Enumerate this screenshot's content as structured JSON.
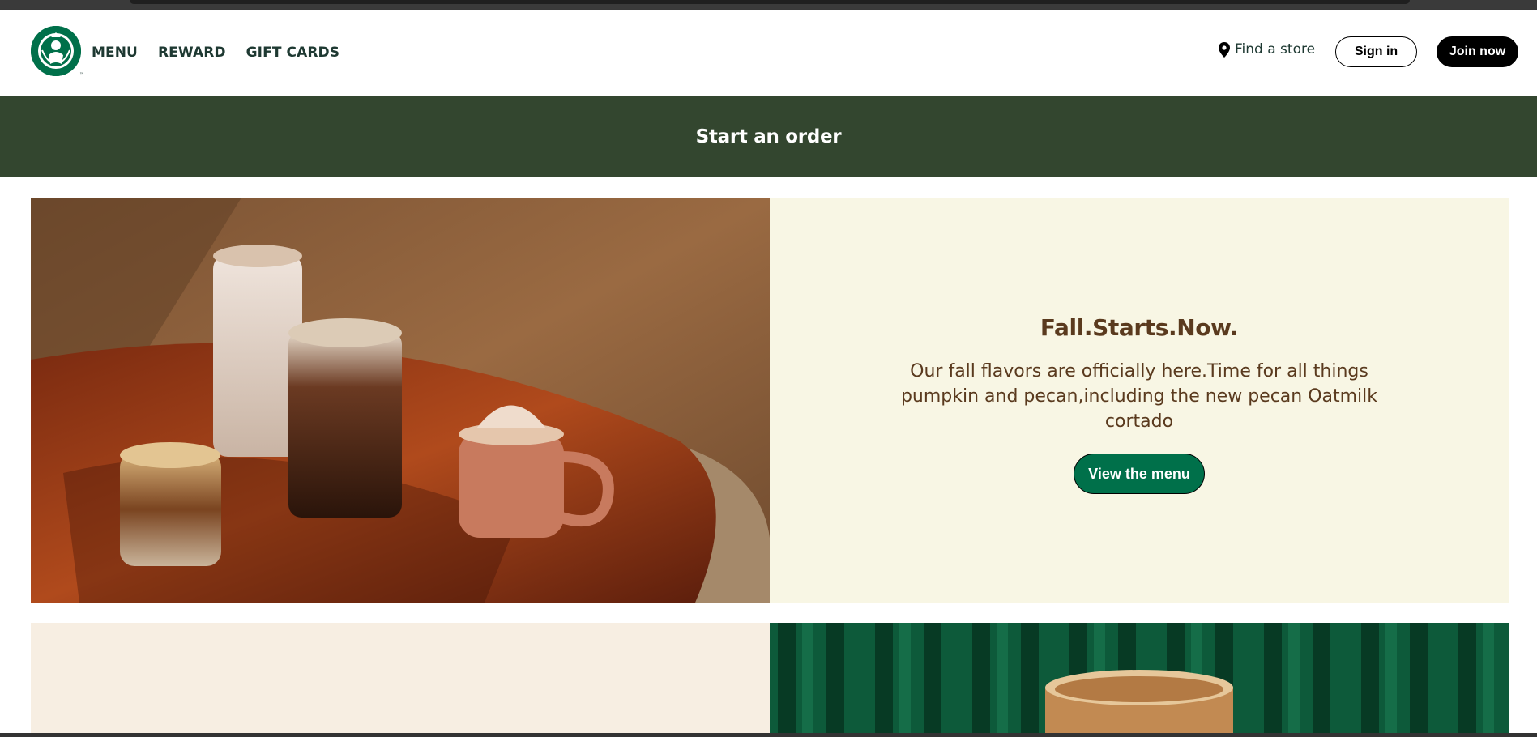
{
  "header": {
    "logo_alt": "Starbucks",
    "nav": [
      "MENU",
      "REWARD",
      "GIFT CARDS"
    ],
    "find_store": "Find a store",
    "sign_in": "Sign in",
    "join_now": "Join now"
  },
  "order_bar": {
    "label": "Start an order"
  },
  "hero": {
    "title": "Fall.Starts.Now.",
    "body": "Our fall flavors are officially here.Time for all things pumpkin and pecan,including the new pecan Oatmilk cortado",
    "cta": "View the menu"
  },
  "colors": {
    "brand_green": "#00704a",
    "order_bar": "#33462f",
    "hero_panel": "#f8f6e4",
    "hero_text": "#5a3a1e",
    "second_panel": "#f7eee2"
  },
  "icons": {
    "location": "map-pin-icon",
    "logo": "siren-logo-icon"
  }
}
